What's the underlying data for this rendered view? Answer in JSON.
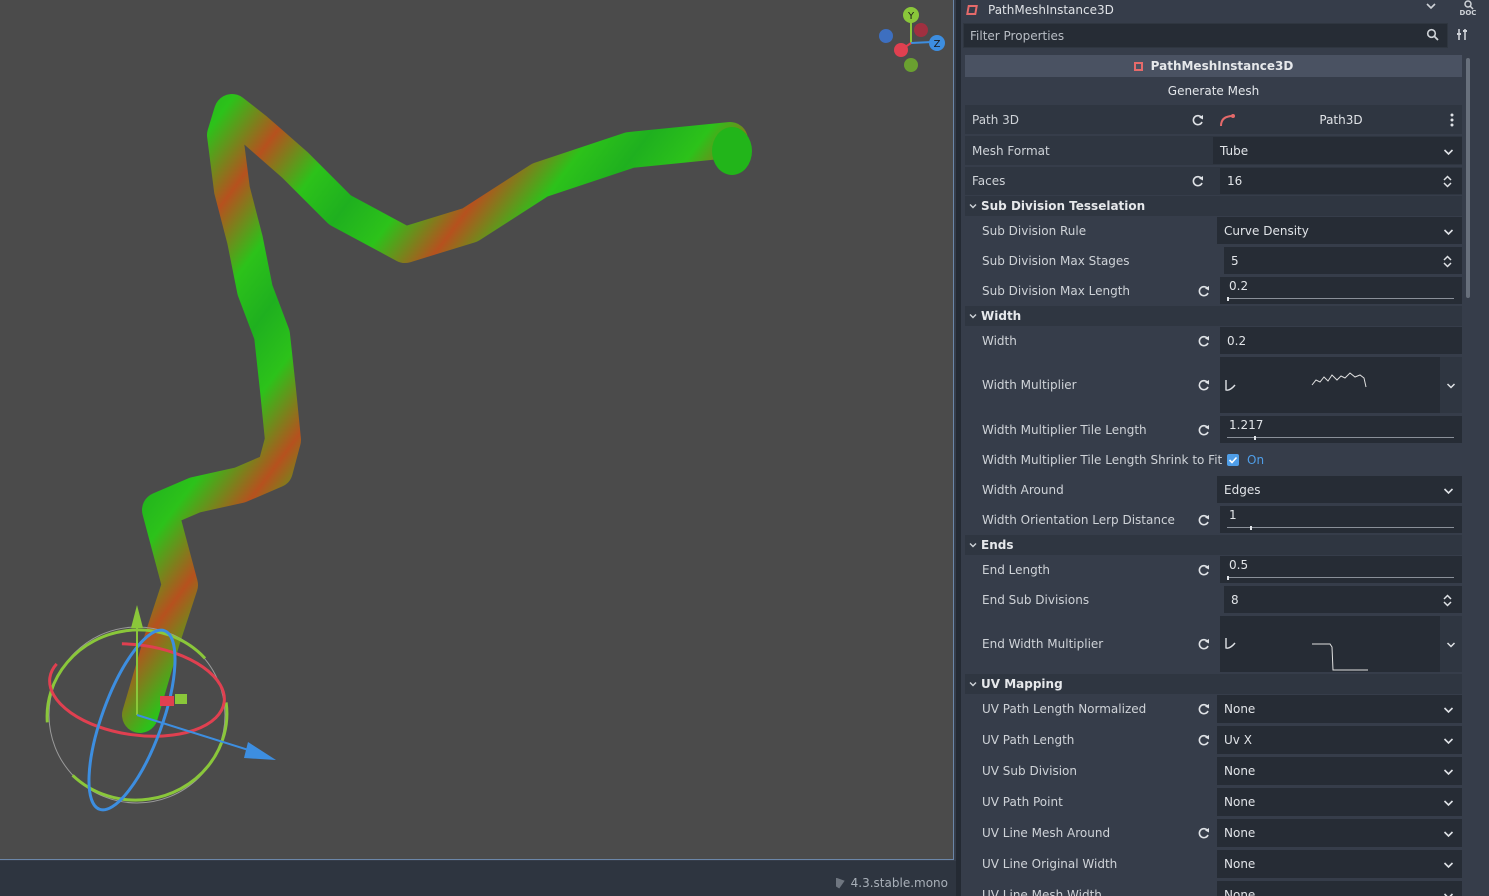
{
  "viewport": {
    "version": "4.3.stable.mono",
    "gizmo_axes": [
      "Y",
      "Z"
    ]
  },
  "inspector": {
    "node_name": "PathMeshInstance3D",
    "filter_placeholder": "Filter Properties",
    "doc_label": "DOC",
    "class_name": "PathMeshInstance3D",
    "generate_button": "Generate Mesh",
    "props": {
      "path3d": {
        "label": "Path 3D",
        "value": "Path3D"
      },
      "mesh_format": {
        "label": "Mesh Format",
        "value": "Tube"
      },
      "faces": {
        "label": "Faces",
        "value": "16"
      }
    },
    "sections": {
      "subdiv": "Sub Division Tesselation",
      "width": "Width",
      "ends": "Ends",
      "uv": "UV Mapping"
    },
    "subdiv": {
      "rule": {
        "label": "Sub Division Rule",
        "value": "Curve Density"
      },
      "max_stages": {
        "label": "Sub Division Max Stages",
        "value": "5"
      },
      "max_length": {
        "label": "Sub Division Max Length",
        "value": "0.2",
        "fraction": 0.0
      }
    },
    "width": {
      "width": {
        "label": "Width",
        "value": "0.2"
      },
      "multiplier": {
        "label": "Width Multiplier"
      },
      "tile_length": {
        "label": "Width Multiplier Tile Length",
        "value": "1.217",
        "fraction": 0.12
      },
      "shrink": {
        "label": "Width Multiplier Tile Length Shrink to Fit",
        "value": "On"
      },
      "around": {
        "label": "Width Around",
        "value": "Edges"
      },
      "lerp": {
        "label": "Width Orientation Lerp Distance",
        "value": "1",
        "fraction": 0.1
      }
    },
    "ends": {
      "length": {
        "label": "End Length",
        "value": "0.5",
        "fraction": 0.0
      },
      "subdivs": {
        "label": "End Sub Divisions",
        "value": "8"
      },
      "width_mult": {
        "label": "End Width Multiplier"
      }
    },
    "uv": [
      {
        "label": "UV Path Length Normalized",
        "value": "None"
      },
      {
        "label": "UV Path Length",
        "value": "Uv X"
      },
      {
        "label": "UV Sub Division",
        "value": "None"
      },
      {
        "label": "UV Path Point",
        "value": "None"
      },
      {
        "label": "UV Line Mesh Around",
        "value": "None"
      },
      {
        "label": "UV Line Original Width",
        "value": "None"
      },
      {
        "label": "UV Line Mesh Width",
        "value": "None"
      }
    ]
  },
  "colors": {
    "accent": "#4f9ee8",
    "node_icon": "#e56a6a"
  }
}
